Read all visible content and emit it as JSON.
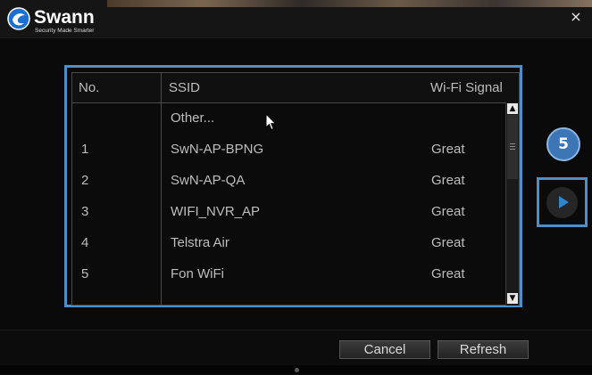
{
  "brand": {
    "name": "Swann",
    "tagline": "Security Made Smarter"
  },
  "dialog": {
    "close_label": "×"
  },
  "table": {
    "headers": {
      "no": "No.",
      "ssid": "SSID",
      "signal": "Wi-Fi Signal"
    },
    "rows": [
      {
        "no": "",
        "ssid": "Other...",
        "signal": ""
      },
      {
        "no": "1",
        "ssid": "SwN-AP-BPNG",
        "signal": "Great"
      },
      {
        "no": "2",
        "ssid": "SwN-AP-QA",
        "signal": "Great"
      },
      {
        "no": "3",
        "ssid": "WIFI_NVR_AP",
        "signal": "Great"
      },
      {
        "no": "4",
        "ssid": "Telstra Air",
        "signal": "Great"
      },
      {
        "no": "5",
        "ssid": "Fon WiFi",
        "signal": "Great"
      }
    ]
  },
  "callout": {
    "step": "5"
  },
  "footer": {
    "cancel_label": "Cancel",
    "refresh_label": "Refresh"
  },
  "icons": {
    "play": "play-icon",
    "close": "close-icon",
    "cursor": "mouse-cursor-icon"
  },
  "colors": {
    "highlight": "#4f8fc8",
    "badge": "#3c76b5",
    "play": "#2f86c9",
    "background": "#0d0d0d"
  }
}
